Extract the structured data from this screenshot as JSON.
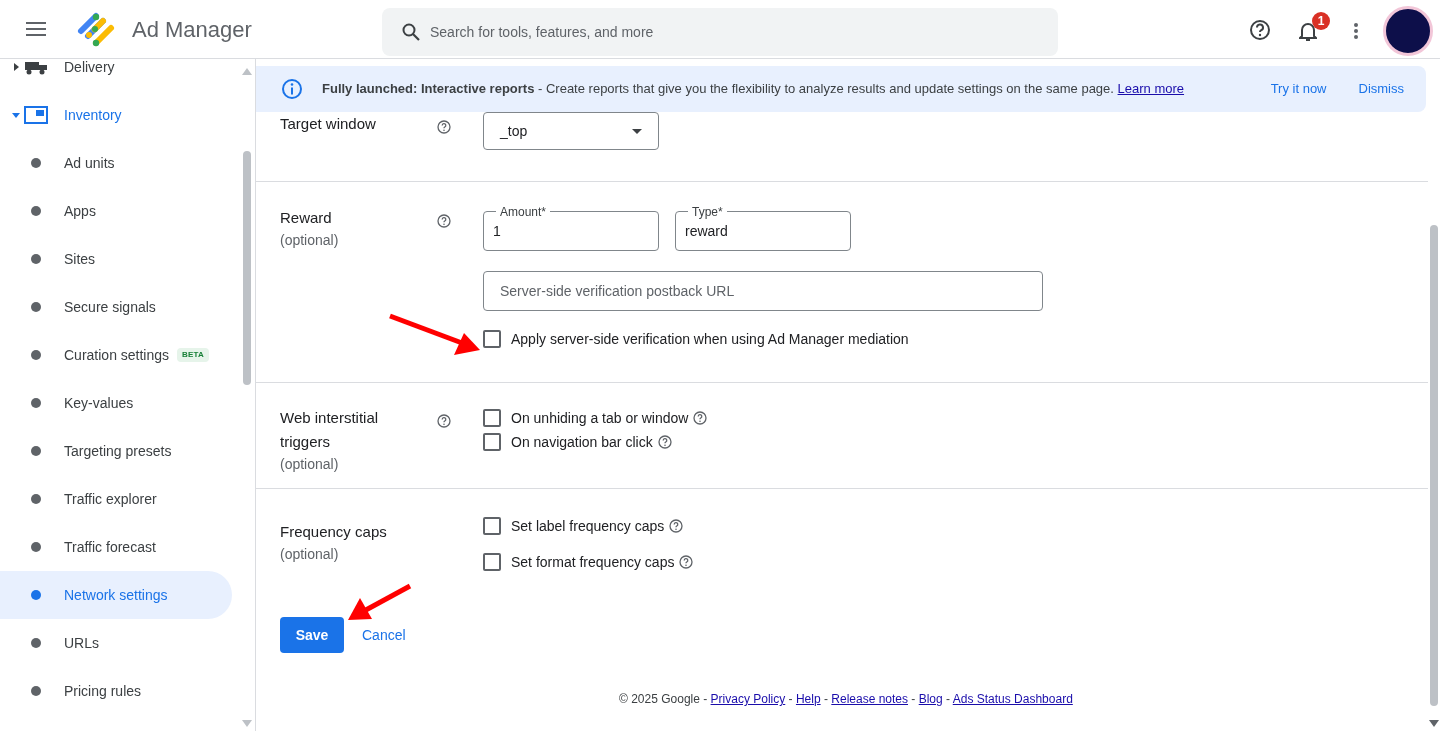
{
  "header": {
    "title": "Ad Manager",
    "search": {
      "placeholder": "Search for tools, features, and more"
    },
    "notification_count": "1"
  },
  "sidebar": {
    "items": [
      {
        "kind": "section",
        "label": "Delivery",
        "expanded": false,
        "active": false
      },
      {
        "kind": "section",
        "label": "Inventory",
        "expanded": true,
        "active": true
      },
      {
        "kind": "item",
        "label": "Ad units",
        "selected": false
      },
      {
        "kind": "item",
        "label": "Apps",
        "selected": false
      },
      {
        "kind": "item",
        "label": "Sites",
        "selected": false
      },
      {
        "kind": "item",
        "label": "Secure signals",
        "selected": false
      },
      {
        "kind": "item",
        "label": "Curation settings",
        "selected": false,
        "badge": "BETA"
      },
      {
        "kind": "item",
        "label": "Key-values",
        "selected": false
      },
      {
        "kind": "item",
        "label": "Targeting presets",
        "selected": false
      },
      {
        "kind": "item",
        "label": "Traffic explorer",
        "selected": false
      },
      {
        "kind": "item",
        "label": "Traffic forecast",
        "selected": false
      },
      {
        "kind": "item",
        "label": "Network settings",
        "selected": true
      },
      {
        "kind": "item",
        "label": "URLs",
        "selected": false
      },
      {
        "kind": "item",
        "label": "Pricing rules",
        "selected": false
      }
    ]
  },
  "banner": {
    "text": "**Fully launched: Interactive reports** - Create reports that give you the flexibility to analyze results and update settings on the same page.",
    "link": "Learn more",
    "actions": [
      "Try it now",
      "Dismiss"
    ]
  },
  "form": {
    "sections": [
      {
        "label": "Target window",
        "help": true,
        "controls": [
          {
            "kind": "select",
            "value": "_top"
          }
        ]
      },
      {
        "label": "Reward",
        "note": "(optional)",
        "help": true,
        "controls": [
          {
            "kind": "field_pair",
            "fields": [
              {
                "label": "Amount*",
                "value": "1"
              },
              {
                "label": "Type*",
                "value": "reward"
              }
            ]
          },
          {
            "kind": "text_field",
            "placeholder": "Server-side verification postback URL"
          },
          {
            "kind": "checkbox",
            "label": "Apply server-side verification when using Ad Manager mediation",
            "checked": false
          }
        ]
      },
      {
        "label": "Web interstitial triggers",
        "note": "(optional)",
        "help": true,
        "controls": [
          {
            "kind": "checkbox",
            "label": "On unhiding a tab or window",
            "checked": false,
            "help": true
          },
          {
            "kind": "checkbox",
            "label": "On navigation bar click",
            "checked": false,
            "help": true
          }
        ]
      },
      {
        "label": "Frequency caps",
        "note": "(optional)",
        "controls": [
          {
            "kind": "checkbox",
            "label": "Set label frequency caps",
            "checked": false,
            "help": true
          },
          {
            "kind": "checkbox",
            "label": "Set format frequency caps",
            "checked": false,
            "help": true
          }
        ]
      }
    ],
    "buttons": {
      "save": "Save",
      "cancel": "Cancel"
    }
  },
  "footer": {
    "prefix": "© 2025 Google -",
    "separator": "-",
    "links": [
      "Privacy Policy",
      "Help",
      "Release notes",
      "Blog",
      "Ads Status Dashboard"
    ]
  }
}
